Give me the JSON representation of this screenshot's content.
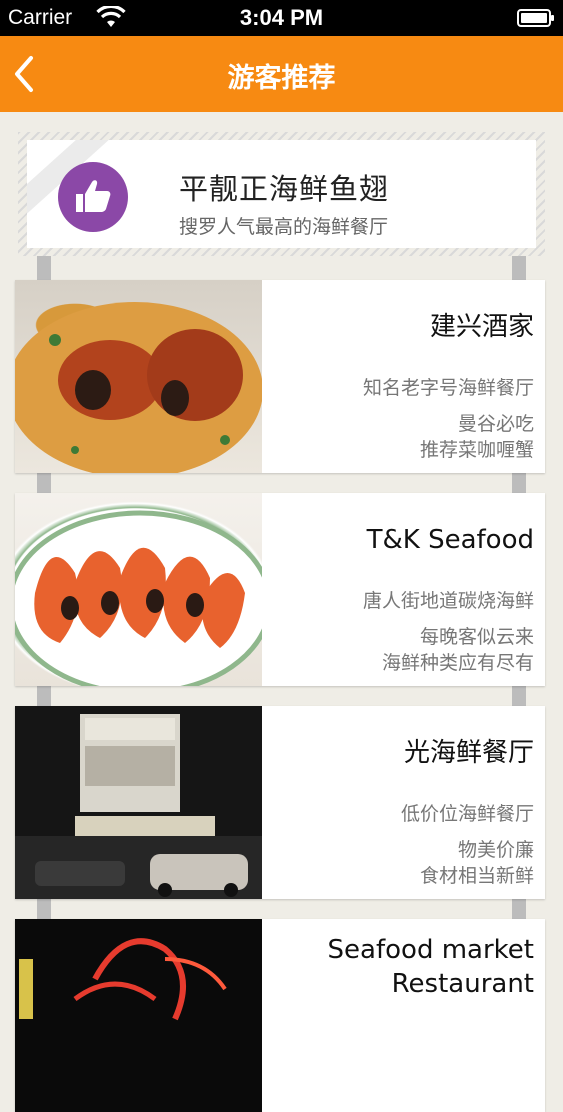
{
  "status_bar": {
    "carrier": "Carrier",
    "time": "3:04 PM"
  },
  "nav": {
    "title": "游客推荐"
  },
  "banner": {
    "title": "平靓正海鲜鱼翅",
    "subtitle": "搜罗人气最高的海鲜餐厅",
    "icon": "thumbs-up-icon"
  },
  "restaurants": [
    {
      "name": "建兴酒家",
      "tagline": "知名老字号海鲜餐厅",
      "line1": "曼谷必吃",
      "line2": "推荐菜咖喱蟹"
    },
    {
      "name": "T&K Seafood",
      "tagline": "唐人街地道碳烧海鲜",
      "line1": "每晚客似云来",
      "line2": "海鲜种类应有尽有"
    },
    {
      "name": "光海鲜餐厅",
      "tagline": "低价位海鲜餐厅",
      "line1": "物美价廉",
      "line2": "食材相当新鲜"
    },
    {
      "name": "Seafood market Restaurant"
    }
  ],
  "colors": {
    "nav_background": "#f78a12",
    "banner_icon": "#8b48a7",
    "page_background": "#efede6"
  }
}
